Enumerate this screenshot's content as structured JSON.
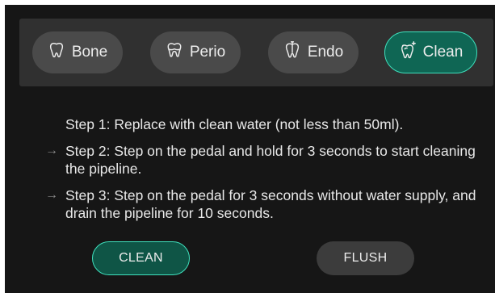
{
  "modes": {
    "bone": {
      "label": "Bone",
      "icon": "tooth-icon"
    },
    "perio": {
      "label": "Perio",
      "icon": "tooth-crown-icon"
    },
    "endo": {
      "label": "Endo",
      "icon": "tooth-root-canal-icon"
    },
    "clean": {
      "label": "Clean",
      "icon": "tooth-sparkle-icon",
      "active": true
    }
  },
  "steps": [
    {
      "arrow": "",
      "text": "Step 1: Replace with clean water (not less than 50ml)."
    },
    {
      "arrow": "→",
      "text": "Step 2: Step on the pedal and hold for 3 seconds to start cleaning the pipeline."
    },
    {
      "arrow": "→",
      "text": "Step 3: Step on the pedal for 3 seconds without water supply, and drain the pipeline for 10 seconds."
    }
  ],
  "actions": {
    "clean": "CLEAN",
    "flush": "FLUSH"
  },
  "colors": {
    "accent": "#3fe0bd",
    "active_fill": "#0f6654",
    "background": "#161616",
    "panel": "#303030"
  }
}
